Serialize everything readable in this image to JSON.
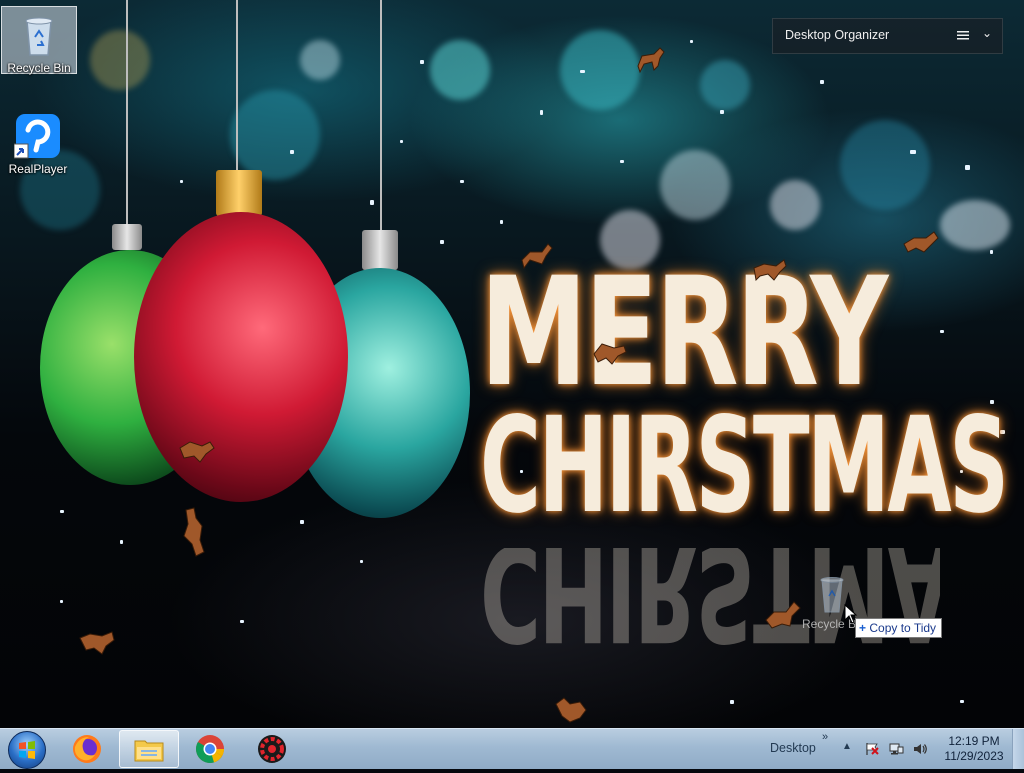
{
  "desktop_icons": [
    {
      "label": "Recycle Bin",
      "icon": "recycle-bin-icon"
    },
    {
      "label": "RealPlayer",
      "icon": "realplayer-icon"
    }
  ],
  "organizer": {
    "title": "Desktop Organizer",
    "menu_icon": "hamburger-menu-icon",
    "collapse_icon": "chevron-down-icon"
  },
  "drag": {
    "ghost_label": "Recycle B",
    "tooltip": "Copy to Tidy",
    "tooltip_icon": "plus-icon"
  },
  "wallpaper": {
    "line1": "MERRY",
    "line2": "CHIRSTMAS"
  },
  "taskbar": {
    "start_icon": "windows-start-icon",
    "pinned": [
      {
        "name": "firefox",
        "icon": "firefox-icon"
      },
      {
        "name": "file-explorer",
        "icon": "folder-icon",
        "active": true
      },
      {
        "name": "chrome",
        "icon": "chrome-icon"
      },
      {
        "name": "app",
        "icon": "red-gear-app-icon"
      }
    ],
    "toolbar_label": "Desktop",
    "toolbar_chevron": "»",
    "tray": [
      "show-hidden-icons",
      "flag-icon",
      "network-icon",
      "volume-icon"
    ],
    "time": "12:19 PM",
    "date": "11/29/2023"
  }
}
